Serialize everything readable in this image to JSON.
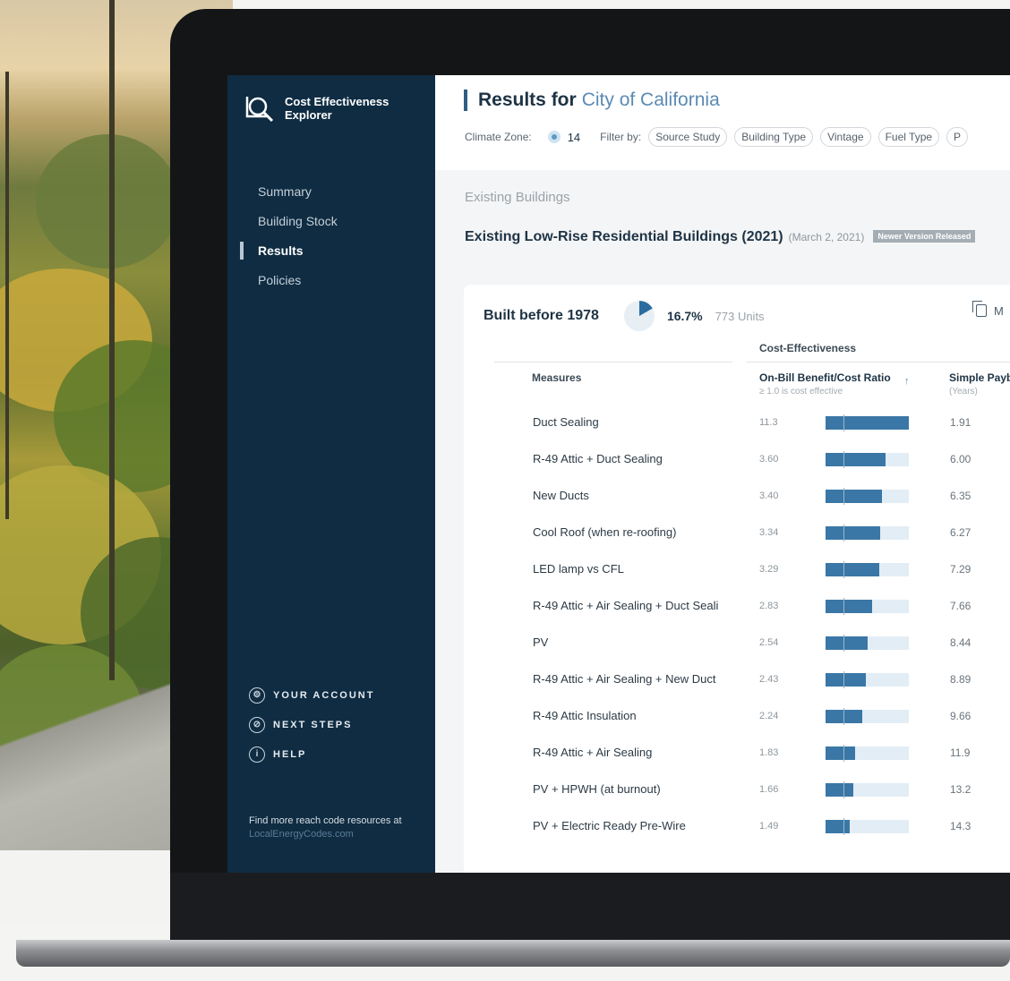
{
  "app": {
    "name": "Cost Effectiveness Explorer"
  },
  "sidebar": {
    "nav": [
      "Summary",
      "Building Stock",
      "Results",
      "Policies"
    ],
    "active_index": 2,
    "links": [
      {
        "label": "YOUR ACCOUNT",
        "icon": "gear-icon"
      },
      {
        "label": "NEXT STEPS",
        "icon": "compass-icon"
      },
      {
        "label": "HELP",
        "icon": "info-icon"
      }
    ],
    "footer_text": "Find more reach code resources at",
    "footer_link": "LocalEnergyCodes.com"
  },
  "header": {
    "title_prefix": "Results for",
    "city": "City of California",
    "climate_zone_label": "Climate Zone:",
    "climate_zone_value": "14",
    "filter_label": "Filter by:",
    "filters": [
      "Source Study",
      "Building Type",
      "Vintage",
      "Fuel Type",
      "P"
    ]
  },
  "section": {
    "label": "Existing Buildings"
  },
  "study": {
    "title": "Existing Low-Rise Residential Buildings (2021)",
    "date": "(March 2, 2021)",
    "badge": "Newer Version Released"
  },
  "card": {
    "vintage": "Built before 1978",
    "share_pct": "16.7%",
    "share_value": 0.167,
    "units": "773 Units",
    "copy_label": "M",
    "group_label": "Cost-Effectiveness",
    "col_measures": "Measures",
    "col_ratio": "On-Bill Benefit/Cost Ratio",
    "col_ratio_sub": "≥ 1.0 is cost effective",
    "col_payback": "Simple Payb",
    "col_payback_sub": "(Years)"
  },
  "measures": [
    {
      "name": "Duct Sealing",
      "ratio": "11.3",
      "bar": 1.0,
      "payback": "1.91"
    },
    {
      "name": "R-49 Attic + Duct Sealing",
      "ratio": "3.60",
      "bar": 0.72,
      "payback": "6.00"
    },
    {
      "name": "New Ducts",
      "ratio": "3.40",
      "bar": 0.68,
      "payback": "6.35"
    },
    {
      "name": "Cool Roof (when re-roofing)",
      "ratio": "3.34",
      "bar": 0.66,
      "payback": "6.27"
    },
    {
      "name": "LED lamp vs CFL",
      "ratio": "3.29",
      "bar": 0.65,
      "payback": "7.29"
    },
    {
      "name": "R-49 Attic + Air Sealing + Duct Seali",
      "ratio": "2.83",
      "bar": 0.56,
      "payback": "7.66"
    },
    {
      "name": "PV",
      "ratio": "2.54",
      "bar": 0.5,
      "payback": "8.44"
    },
    {
      "name": "R-49 Attic + Air Sealing + New Duct",
      "ratio": "2.43",
      "bar": 0.48,
      "payback": "8.89"
    },
    {
      "name": "R-49 Attic Insulation",
      "ratio": "2.24",
      "bar": 0.44,
      "payback": "9.66"
    },
    {
      "name": "R-49 Attic + Air Sealing",
      "ratio": "1.83",
      "bar": 0.36,
      "payback": "11.9"
    },
    {
      "name": "PV + HPWH (at burnout)",
      "ratio": "1.66",
      "bar": 0.33,
      "payback": "13.2"
    },
    {
      "name": "PV + Electric Ready Pre-Wire",
      "ratio": "1.49",
      "bar": 0.29,
      "payback": "14.3"
    }
  ],
  "colors": {
    "sidebar": "#0f2c42",
    "accent": "#3a77a6",
    "bar_track": "#e3edf5"
  }
}
